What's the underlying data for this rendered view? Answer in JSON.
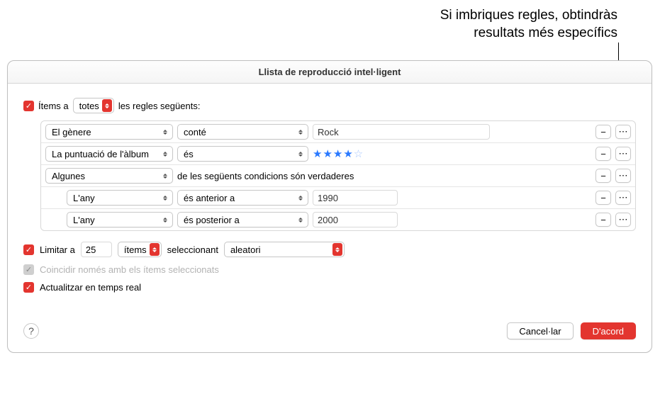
{
  "annotation": {
    "line1": "Si imbriques regles, obtindràs",
    "line2": "resultats més específics"
  },
  "dialog": {
    "title": "Llista de reproducció intel·ligent",
    "match": {
      "prefix": "Ítems a",
      "mode": "totes",
      "suffix": "les regles següents:"
    },
    "rules": [
      {
        "field": "El gènere",
        "op": "conté",
        "value": "Rock",
        "nested": false,
        "kind": "text"
      },
      {
        "field": "La puntuació de l'àlbum",
        "op": "és",
        "value": 4,
        "max": 5,
        "nested": false,
        "kind": "rating"
      },
      {
        "field": "Algunes",
        "op": "",
        "value": "de les següents condicions són verdaderes",
        "nested": false,
        "kind": "group"
      },
      {
        "field": "L'any",
        "op": "és anterior a",
        "value": "1990",
        "nested": true,
        "kind": "text"
      },
      {
        "field": "L'any",
        "op": "és posterior a",
        "value": "2000",
        "nested": true,
        "kind": "text"
      }
    ],
    "limit": {
      "label": "Limitar a",
      "count": "25",
      "unit": "ítems",
      "selecting": "seleccionant",
      "method": "aleatori"
    },
    "match_checked": "Coincidir només amb els ítems seleccionats",
    "live_update": "Actualitzar en temps real",
    "buttons": {
      "cancel": "Cancel·lar",
      "ok": "D'acord"
    }
  }
}
